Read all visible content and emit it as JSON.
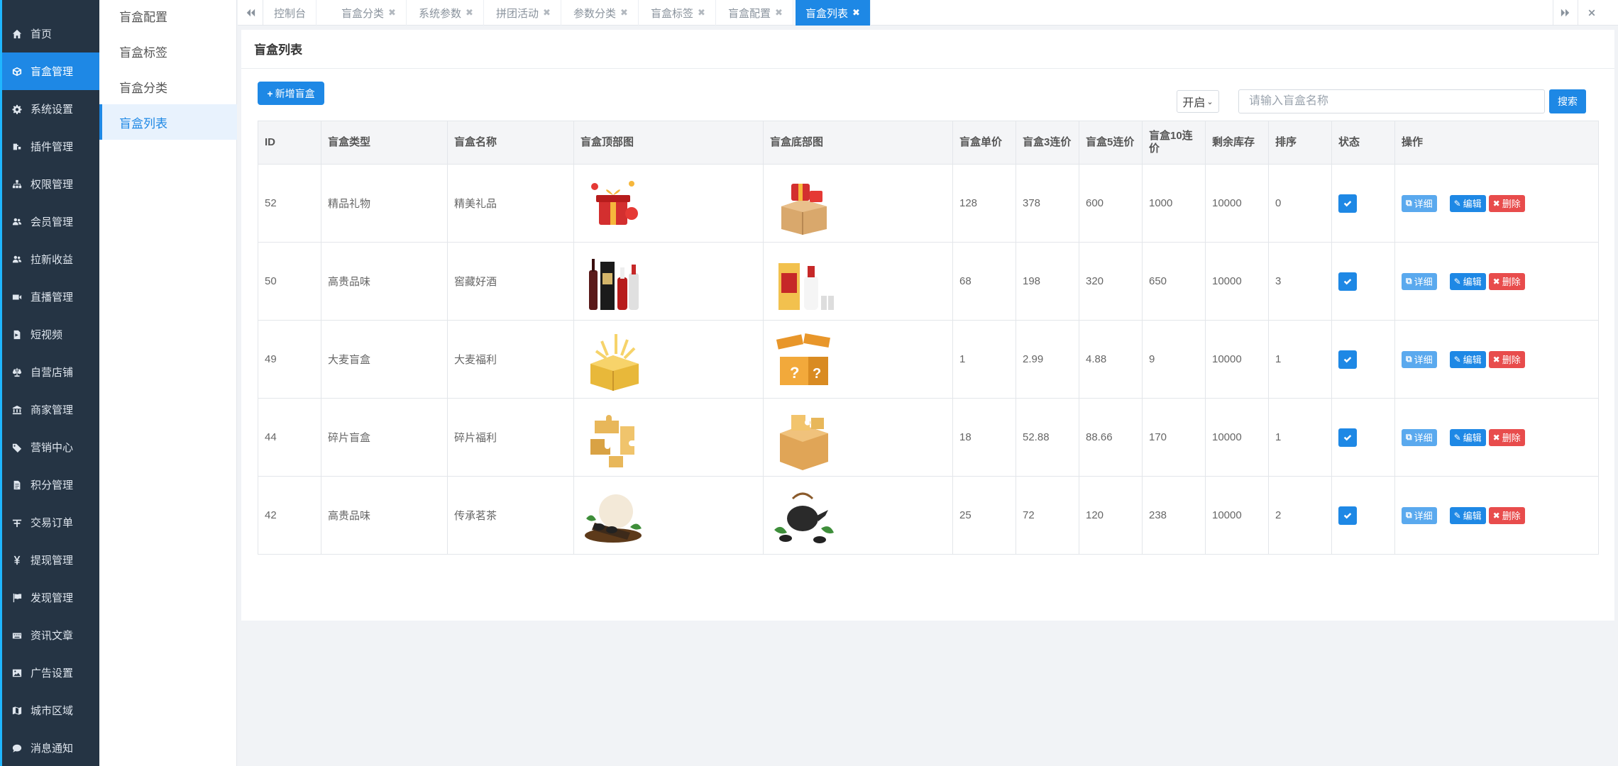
{
  "sidebar": {
    "items": [
      {
        "label": "首页",
        "icon": "home-icon"
      },
      {
        "label": "盲盒管理",
        "icon": "cube-icon",
        "active": true
      },
      {
        "label": "系统设置",
        "icon": "gear-icon"
      },
      {
        "label": "插件管理",
        "icon": "plugin-icon"
      },
      {
        "label": "权限管理",
        "icon": "sitemap-icon"
      },
      {
        "label": "会员管理",
        "icon": "users-icon"
      },
      {
        "label": "拉新收益",
        "icon": "users-icon"
      },
      {
        "label": "直播管理",
        "icon": "video-camera-icon"
      },
      {
        "label": "短视频",
        "icon": "file-video-icon"
      },
      {
        "label": "自营店铺",
        "icon": "balance-scale-icon"
      },
      {
        "label": "商家管理",
        "icon": "bank-icon"
      },
      {
        "label": "营销中心",
        "icon": "tag-icon"
      },
      {
        "label": "积分管理",
        "icon": "file-text-icon"
      },
      {
        "label": "交易订单",
        "icon": "orders-icon"
      },
      {
        "label": "提现管理",
        "icon": "yen-icon"
      },
      {
        "label": "发现管理",
        "icon": "flag-icon"
      },
      {
        "label": "资讯文章",
        "icon": "keyboard-icon"
      },
      {
        "label": "广告设置",
        "icon": "image-icon"
      },
      {
        "label": "城市区域",
        "icon": "map-icon"
      },
      {
        "label": "消息通知",
        "icon": "comment-icon"
      }
    ]
  },
  "submenu": {
    "items": [
      {
        "label": "盲盒配置"
      },
      {
        "label": "盲盒标签"
      },
      {
        "label": "盲盒分类"
      },
      {
        "label": "盲盒列表",
        "active": true
      }
    ]
  },
  "tabs": {
    "items": [
      {
        "label": "控制台",
        "closable": false
      },
      {
        "label": "盲盒分类",
        "closable": true
      },
      {
        "label": "系统参数",
        "closable": true
      },
      {
        "label": "拼团活动",
        "closable": true
      },
      {
        "label": "参数分类",
        "closable": true
      },
      {
        "label": "盲盒标签",
        "closable": true
      },
      {
        "label": "盲盒配置",
        "closable": true
      },
      {
        "label": "盲盒列表",
        "closable": true,
        "active": true
      }
    ],
    "close_glyph": "✖"
  },
  "page": {
    "title": "盲盒列表",
    "add_button_label": "新增盲盒",
    "add_button_icon": "+",
    "status_select_value": "开启",
    "search_placeholder": "请输入盲盒名称",
    "search_button_label": "搜索"
  },
  "table": {
    "headers": [
      "ID",
      "盲盒类型",
      "盲盒名称",
      "盲盒顶部图",
      "盲盒底部图",
      "盲盒单价",
      "盲盒3连价",
      "盲盒5连价",
      "盲盒10连价",
      "剩余库存",
      "排序",
      "状态",
      "操作"
    ],
    "rows": [
      {
        "id": "52",
        "type": "精品礼物",
        "name": "精美礼品",
        "top_img": "gift-image",
        "bottom_img": "gift-box-image",
        "price1": "128",
        "price3": "378",
        "price5": "600",
        "price10": "1000",
        "stock": "10000",
        "sort": "0",
        "status": true
      },
      {
        "id": "50",
        "type": "高贵品味",
        "name": "窖藏好酒",
        "top_img": "liquor-bottles-image",
        "bottom_img": "liquor-box-image",
        "price1": "68",
        "price3": "198",
        "price5": "320",
        "price10": "650",
        "stock": "10000",
        "sort": "3",
        "status": true
      },
      {
        "id": "49",
        "type": "大麦盲盒",
        "name": "大麦福利",
        "top_img": "golden-box-image",
        "bottom_img": "lucky-box-image",
        "price1": "1",
        "price3": "2.99",
        "price5": "4.88",
        "price10": "9",
        "stock": "10000",
        "sort": "1",
        "status": true
      },
      {
        "id": "44",
        "type": "碎片盲盒",
        "name": "碎片福利",
        "top_img": "puzzle-pieces-image",
        "bottom_img": "puzzle-box-image",
        "price1": "18",
        "price3": "52.88",
        "price5": "88.66",
        "price10": "170",
        "stock": "10000",
        "sort": "1",
        "status": true
      },
      {
        "id": "42",
        "type": "高贵品味",
        "name": "传承茗茶",
        "top_img": "tea-set-image",
        "bottom_img": "teapot-image",
        "price1": "25",
        "price3": "72",
        "price5": "120",
        "price10": "238",
        "stock": "10000",
        "sort": "2",
        "status": true
      }
    ],
    "actions": {
      "detail": "详细",
      "edit": "编辑",
      "delete": "删除"
    }
  },
  "colors": {
    "sidebar_bg": "#253444",
    "accent": "#1e88e5",
    "danger": "#e84c4c",
    "detail": "#5aa9ee"
  }
}
